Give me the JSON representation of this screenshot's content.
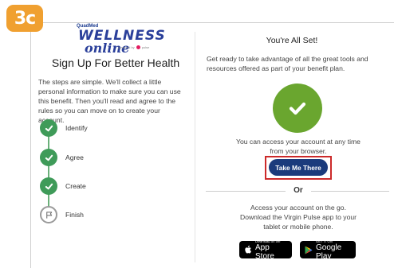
{
  "badge": "3c",
  "logo": {
    "top": "QuadMed",
    "main": "WELLNESS",
    "sub": "online",
    "powered": "powered by",
    "brand": "pulse"
  },
  "left": {
    "title": "Sign Up For Better Health",
    "description": "The steps are simple. We'll collect a little personal information to make sure you can use this benefit. Then you'll read and agree to the rules so you can move on to create your account.",
    "steps": [
      {
        "label": "Identify",
        "status": "complete"
      },
      {
        "label": "Agree",
        "status": "complete"
      },
      {
        "label": "Create",
        "status": "complete"
      },
      {
        "label": "Finish",
        "status": "current"
      }
    ]
  },
  "right": {
    "title": "You're All Set!",
    "description": "Get ready to take advantage of all the great tools and resources offered as part of your benefit plan.",
    "access_text_1": "You can access your account at any time",
    "access_text_2": "from your browser.",
    "button_label": "Take Me There",
    "or_label": "Or",
    "go_text_1": "Access your account on the go.",
    "go_text_2": "Download the Virgin Pulse app to your",
    "go_text_3": "tablet or mobile phone.",
    "app_store": {
      "small": "Download on the",
      "big": "App Store"
    },
    "google_play": {
      "small": "GET IT ON",
      "big": "Google Play"
    }
  },
  "colors": {
    "badge": "#f0a030",
    "step_complete": "#3f9b59",
    "check_circle": "#6aa62f",
    "button": "#1b3b7c",
    "highlight": "#cc2a2a"
  }
}
